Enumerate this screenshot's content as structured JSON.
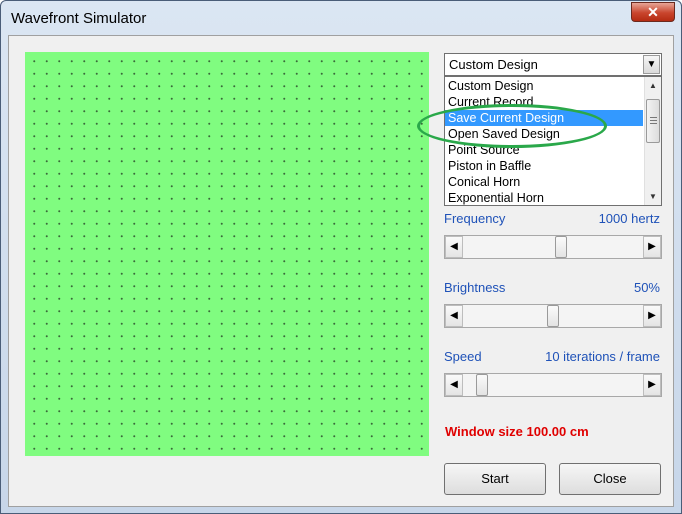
{
  "window": {
    "title": "Wavefront Simulator",
    "close_glyph": "✕"
  },
  "combo": {
    "selected": "Custom Design",
    "arrow_icon": "chevron-down-icon"
  },
  "list": {
    "items": [
      "Custom Design",
      "Current Record",
      "Save Current Design",
      "Open Saved Design",
      "Point Source",
      "Piston in Baffle",
      "Conical Horn",
      "Exponential Horn"
    ],
    "selected_index": 2
  },
  "frequency": {
    "label": "Frequency",
    "value": "1000 hertz",
    "level": 0.55
  },
  "brightness": {
    "label": "Brightness",
    "value": "50%",
    "level": 0.5
  },
  "speed": {
    "label": "Speed",
    "value": "10 iterations / frame",
    "level": 0.08
  },
  "status": {
    "window_size": "Window size 100.00 cm"
  },
  "buttons": {
    "start": "Start",
    "close": "Close"
  },
  "colors": {
    "canvas": "#80fc80",
    "label": "#1f52b8",
    "status": "#e00000",
    "selection": "#3399ff",
    "annotation": "#2aa84a"
  }
}
